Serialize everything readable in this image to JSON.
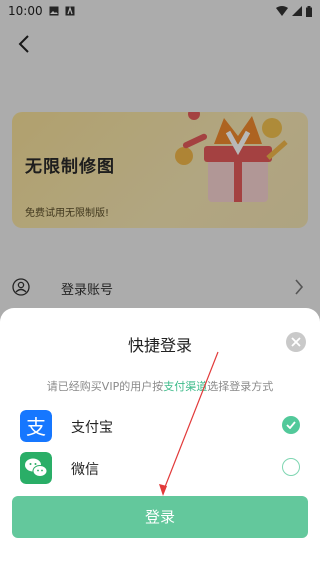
{
  "status_bar": {
    "time": "10:00"
  },
  "banner": {
    "title": "无限制修图",
    "subtitle": "免费试用无限制版!"
  },
  "account_row": {
    "label": "登录账号"
  },
  "sheet": {
    "title": "快捷登录",
    "hint_prefix": "请已经购买VIP的用户按",
    "hint_link": "支付渠道",
    "hint_suffix": "选择登录方式",
    "options": [
      {
        "label": "支付宝",
        "icon": "alipay-icon",
        "selected": true
      },
      {
        "label": "微信",
        "icon": "wechat-icon",
        "selected": false
      }
    ],
    "login_label": "登录"
  },
  "colors": {
    "accent": "#63c89c",
    "link": "#3dbb8a",
    "alipay": "#1677ff",
    "wechat": "#2aae67"
  }
}
